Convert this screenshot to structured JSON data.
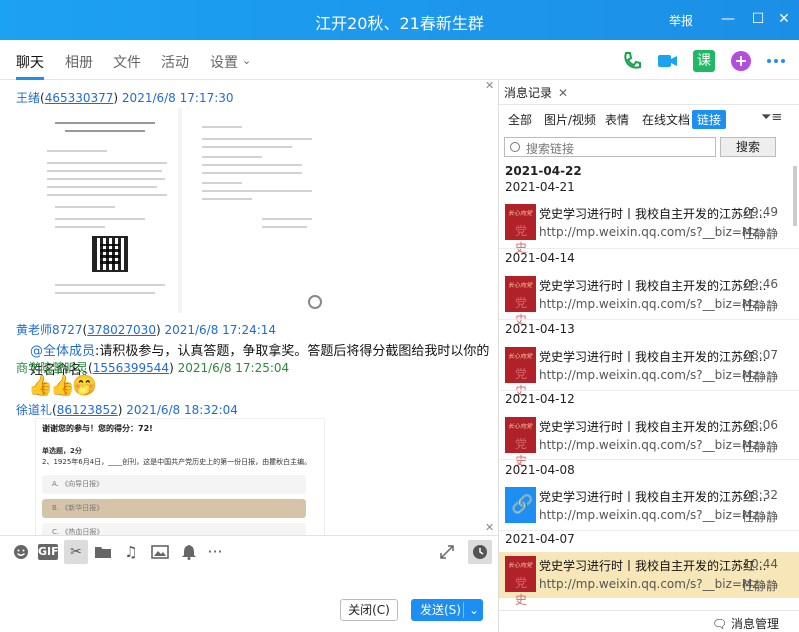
{
  "window": {
    "title": "江开20秋、21春新生群",
    "report": "举报",
    "controls": [
      "minimize",
      "maximize",
      "close"
    ]
  },
  "tabs": [
    {
      "label": "聊天",
      "active": true
    },
    {
      "label": "相册"
    },
    {
      "label": "文件"
    },
    {
      "label": "活动"
    },
    {
      "label": "设置"
    }
  ],
  "header_icons": [
    "phone-icon",
    "video-icon",
    "class-icon",
    "add-icon",
    "more-icon"
  ],
  "header_icon_labels": {
    "class": "课"
  },
  "chat": {
    "messages": [
      {
        "name": "王绪",
        "id": "465330377",
        "time": "2021/6/8 17:17:30",
        "type": "image"
      },
      {
        "name": "黄老师8727",
        "id": "378027030",
        "time": "2021/6/8 17:24:14",
        "mention": "@全体成员",
        "text": ":请积极参与，认真答题，争取拿奖。答题后将得分截图给我时以你的姓名命名。"
      },
      {
        "name": "商学院萱昕灵",
        "id": "1556399544",
        "time": "2021/6/8 17:25:04",
        "type": "emoji"
      },
      {
        "name": "徐道礼",
        "id": "86123852",
        "time": "2021/6/8 18:32:04",
        "type": "image"
      }
    ],
    "quiz": {
      "score": "谢谢您的参与！您的得分：72!",
      "section": "单选题，2分",
      "question": "2、1925年6月4日，____创刊，这是中国共产党历史上的第一份日报，由瞿秋白主编。",
      "options": [
        "A. 《向导日报》",
        "B. 《新华日报》",
        "C. 《热血日报》"
      ]
    }
  },
  "toolbar": {
    "gif_label": "GIF"
  },
  "buttons": {
    "close": "关闭(C)",
    "send": "发送(S)"
  },
  "right_panel": {
    "tab_label": "消息记录",
    "filters": [
      "全部",
      "图片/视频",
      "表情",
      "在线文档",
      "链接"
    ],
    "active_filter": "链接",
    "search_placeholder": "搜索链接",
    "search_button": "搜索",
    "dates": [
      "2021-04-22",
      "2021-04-21",
      "2021-04-14",
      "2021-04-13",
      "2021-04-12",
      "2021-04-08",
      "2021-04-07"
    ],
    "links": [
      {
        "title": "党史学习进行时丨我校自主开发的江苏红...",
        "url": "http://mp.weixin.qq.com/s?__biz=Mz...",
        "time": "09:49",
        "user": "任静静",
        "thumb": "党史"
      },
      {
        "title": "党史学习进行时丨我校自主开发的江苏红...",
        "url": "http://mp.weixin.qq.com/s?__biz=Mz...",
        "time": "09:46",
        "user": "任静静",
        "thumb": "党史"
      },
      {
        "title": "党史学习进行时丨我校自主开发的江苏红...",
        "url": "http://mp.weixin.qq.com/s?__biz=Mz...",
        "time": "08:07",
        "user": "任静静",
        "thumb": "党史"
      },
      {
        "title": "党史学习进行时丨我校自主开发的江苏红...",
        "url": "http://mp.weixin.qq.com/s?__biz=Mz...",
        "time": "08:06",
        "user": "任静静",
        "thumb": "党史"
      },
      {
        "title": "党史学习进行时丨我校自主开发的江苏红...",
        "url": "http://mp.weixin.qq.com/s?__biz=Mz...",
        "time": "08:32",
        "user": "任静静",
        "thumb": "link"
      },
      {
        "title": "党史学习进行时丨我校自主开发的江苏红...",
        "url": "http://mp.weixin.qq.com/s?__biz=Mz...",
        "time": "10:44",
        "user": "任静静",
        "thumb": "党史"
      }
    ],
    "footer": "消息管理"
  }
}
